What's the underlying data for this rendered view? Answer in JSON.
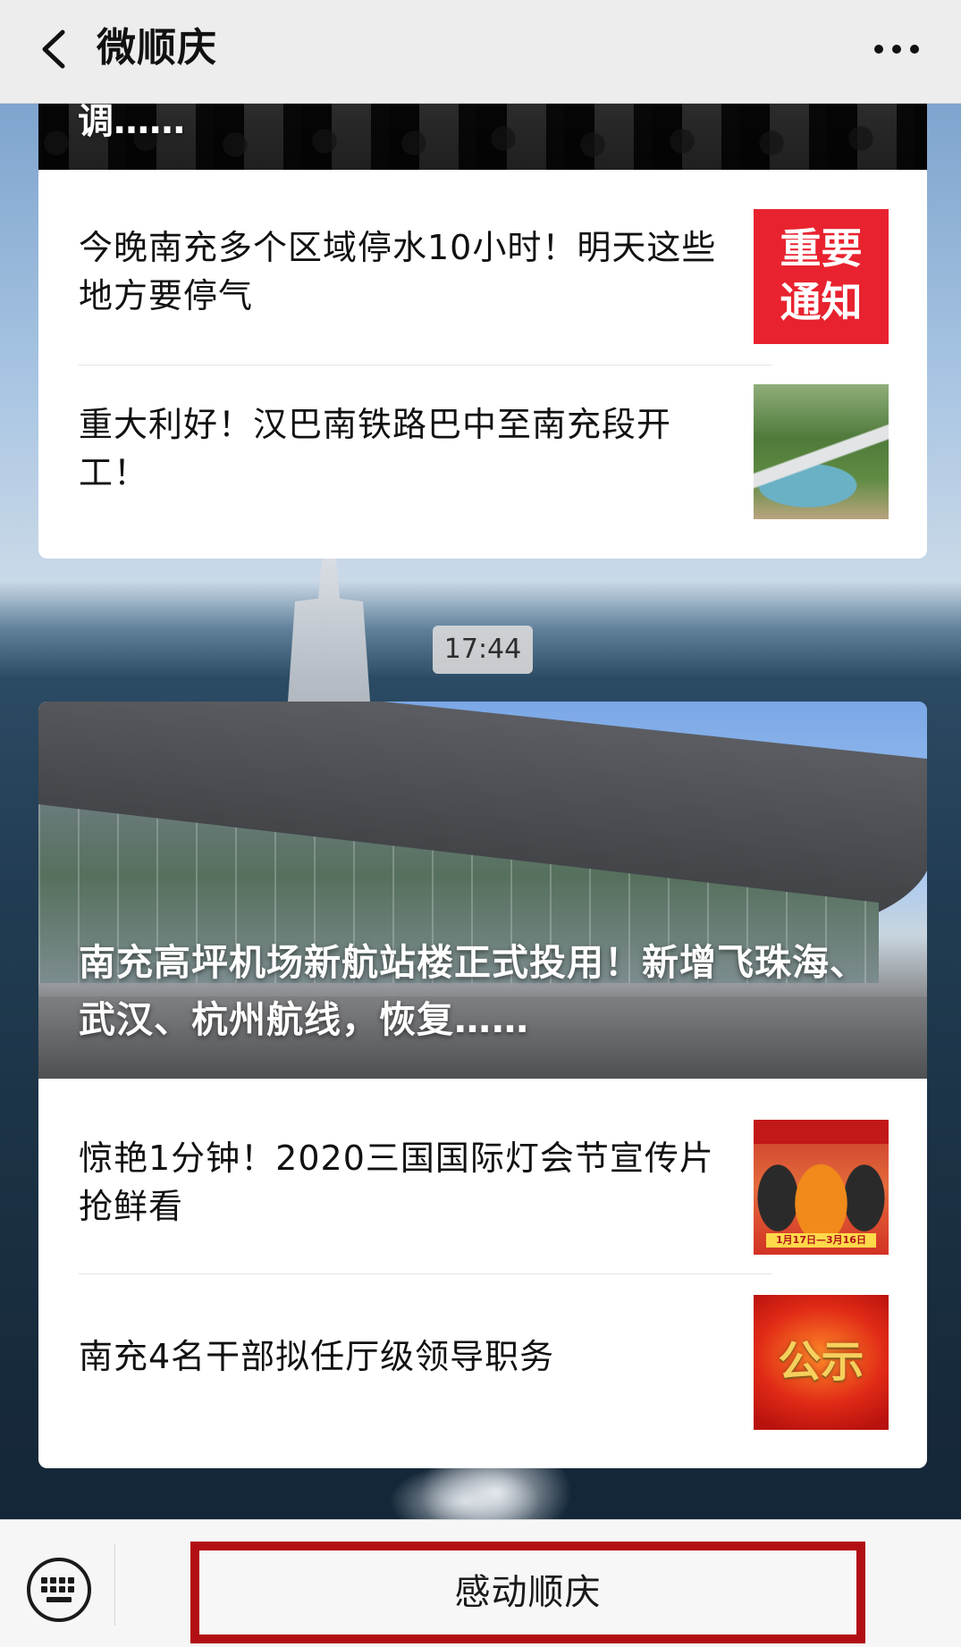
{
  "header": {
    "title": "微顺庆"
  },
  "top_card": {
    "cover_text": "调……",
    "items": [
      {
        "title": "今晚南充多个区域停水10小时！明天这些地方要停气",
        "thumb_lines": [
          "重要",
          "通知"
        ]
      },
      {
        "title": "重大利好！汉巴南铁路巴中至南充段开工！"
      }
    ]
  },
  "timestamp": "17:44",
  "bottom_card": {
    "hero_title": "南充高坪机场新航站楼正式投用！新增飞珠海、武汉、杭州航线，恢复……",
    "items": [
      {
        "title": "惊艳1分钟！2020三国国际灯会节宣传片抢鲜看",
        "thumb_caption": "1月17日—3月16日"
      },
      {
        "title": "南充4名干部拟任厅级领导职务",
        "thumb_text": "公示"
      }
    ]
  },
  "bottom_bar": {
    "menu_label": "感动顺庆"
  },
  "colors": {
    "nav_bg": "#ededed",
    "notice_red": "#e8232f",
    "menu_border": "#b20f15",
    "card_bg": "#ffffff"
  },
  "icons": {
    "back": "chevron-left-icon",
    "more": "more-dots-icon",
    "keyboard": "keyboard-icon"
  }
}
